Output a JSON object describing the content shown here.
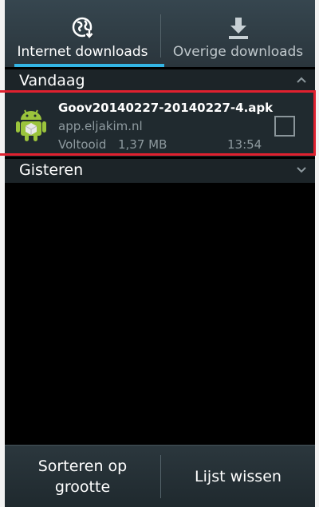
{
  "tabs": [
    {
      "label": "Internet downloads",
      "icon": "globe-download-icon",
      "active": true
    },
    {
      "label": "Overige downloads",
      "icon": "download-arrow-icon",
      "active": false
    }
  ],
  "sections": {
    "today": {
      "title": "Vandaag",
      "icon": "chevron-up-icon"
    },
    "yesterday": {
      "title": "Gisteren",
      "icon": "chevron-down-icon"
    }
  },
  "item": {
    "file_name": "Goov20140227-20140227-4.apk",
    "host": "app.eljakim.nl",
    "status": "Voltooid",
    "size": "1,37 MB",
    "time": "13:54",
    "icon": "android-apk-icon",
    "checked": false
  },
  "bottom_bar": {
    "sort_label": "Sorteren op grootte",
    "clear_label": "Lijst wissen"
  },
  "colors": {
    "accent": "#33b5e5",
    "highlight": "#e0212f"
  }
}
